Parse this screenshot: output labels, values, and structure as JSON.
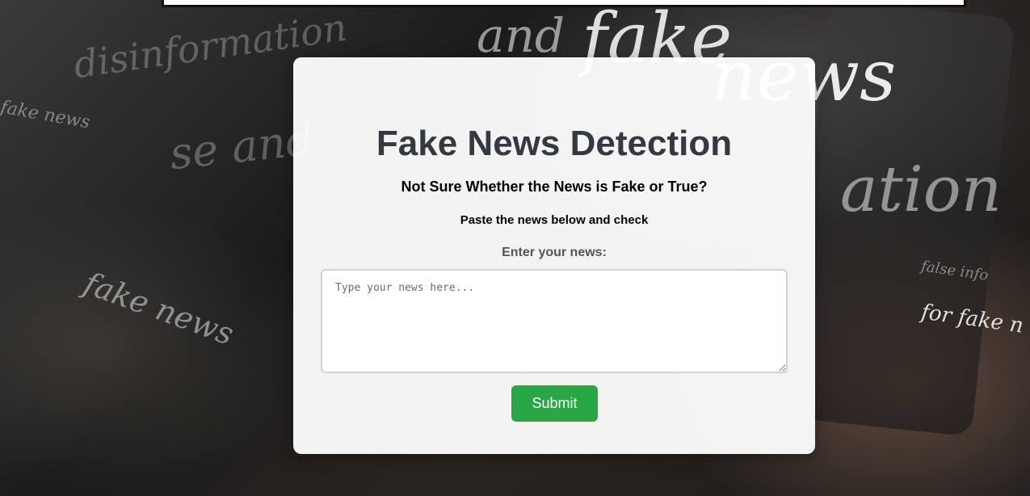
{
  "header": {
    "title": "Fake News Detection",
    "subtitle": "Not Sure Whether the News is Fake or True?",
    "instruction": "Paste the news below and check"
  },
  "form": {
    "label": "Enter your news:",
    "placeholder": "Type your news here...",
    "value": "",
    "submit_label": "Submit"
  },
  "background": {
    "words": [
      "and",
      "fake",
      "news",
      "disinformation",
      "se and",
      "fake news",
      "fake news",
      "for fake n",
      "ation",
      "false info"
    ]
  },
  "colors": {
    "accent": "#28a745",
    "title": "#343a40",
    "card": "#ffffff"
  }
}
